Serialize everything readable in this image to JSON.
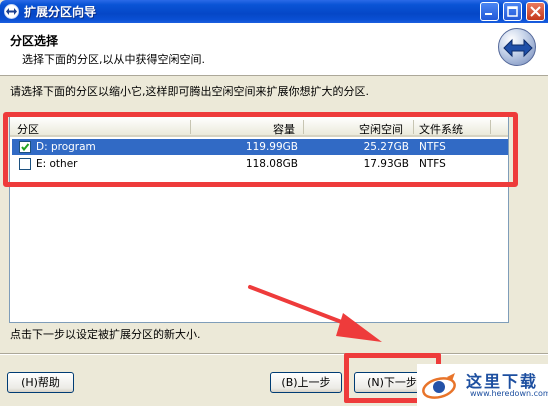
{
  "window": {
    "title": "扩展分区向导"
  },
  "header": {
    "title": "分区选择",
    "subtitle": "选择下面的分区,以从中获得空闲空间."
  },
  "instruction": "请选择下面的分区以缩小它,这样即可腾出空闲空间来扩展你想扩大的分区.",
  "table": {
    "columns": [
      "分区",
      "容量",
      "空闲空间",
      "文件系统"
    ],
    "rows": [
      {
        "checked": true,
        "selected": true,
        "name": "D: program",
        "capacity": "119.99GB",
        "free": "25.27GB",
        "fs": "NTFS"
      },
      {
        "checked": false,
        "selected": false,
        "name": "E: other",
        "capacity": "118.08GB",
        "free": "17.93GB",
        "fs": "NTFS"
      }
    ]
  },
  "hint": "点击下一步以设定被扩展分区的新大小.",
  "buttons": {
    "help": "(H)帮助",
    "back": "(B)上一步",
    "next": "(N)下一步"
  },
  "watermark": {
    "text": "这里下载",
    "url": "www.heredown.com"
  },
  "colors": {
    "annotation_red": "#ee3b3b",
    "selection_blue": "#316ac5",
    "titlebar_blue": "#0a54d6"
  }
}
